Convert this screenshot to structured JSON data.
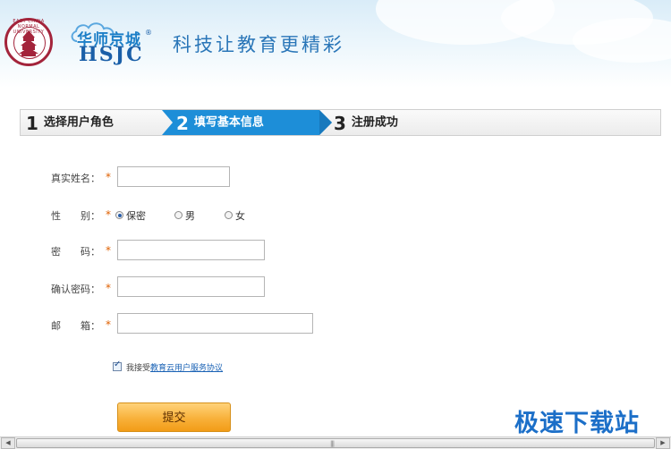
{
  "header": {
    "seal_text": "EAST CHINA NORMAL UNIVERSITY",
    "brand_cn": "华师京城",
    "brand_en": "HSJC",
    "brand_reg": "®",
    "slogan": "科技让教育更精彩"
  },
  "steps": [
    {
      "num": "1",
      "label": "选择用户角色",
      "active": false
    },
    {
      "num": "2",
      "label": "填写基本信息",
      "active": true
    },
    {
      "num": "3",
      "label": "注册成功",
      "active": false
    }
  ],
  "form": {
    "required_mark": "*",
    "real_name": {
      "label": "真实姓名：",
      "value": ""
    },
    "gender": {
      "label": "性　　别：",
      "options": [
        "保密",
        "男",
        "女"
      ],
      "selected": "保密"
    },
    "password": {
      "label": "密　　码：",
      "value": ""
    },
    "confirm_password": {
      "label": "确认密码：",
      "value": ""
    },
    "email": {
      "label": "邮　　箱：",
      "value": ""
    },
    "agreement": {
      "prefix": "我接受",
      "link": "教育云用户服务协议",
      "checked": true
    },
    "submit_label": "提交"
  },
  "watermark": "极速下载站",
  "scrollbar": {
    "left_arrow": "◀",
    "right_arrow": "▶",
    "grip": "|||"
  },
  "colors": {
    "accent_blue": "#1d8ed8",
    "required": "#e06000",
    "submit": "#f8b13a"
  }
}
